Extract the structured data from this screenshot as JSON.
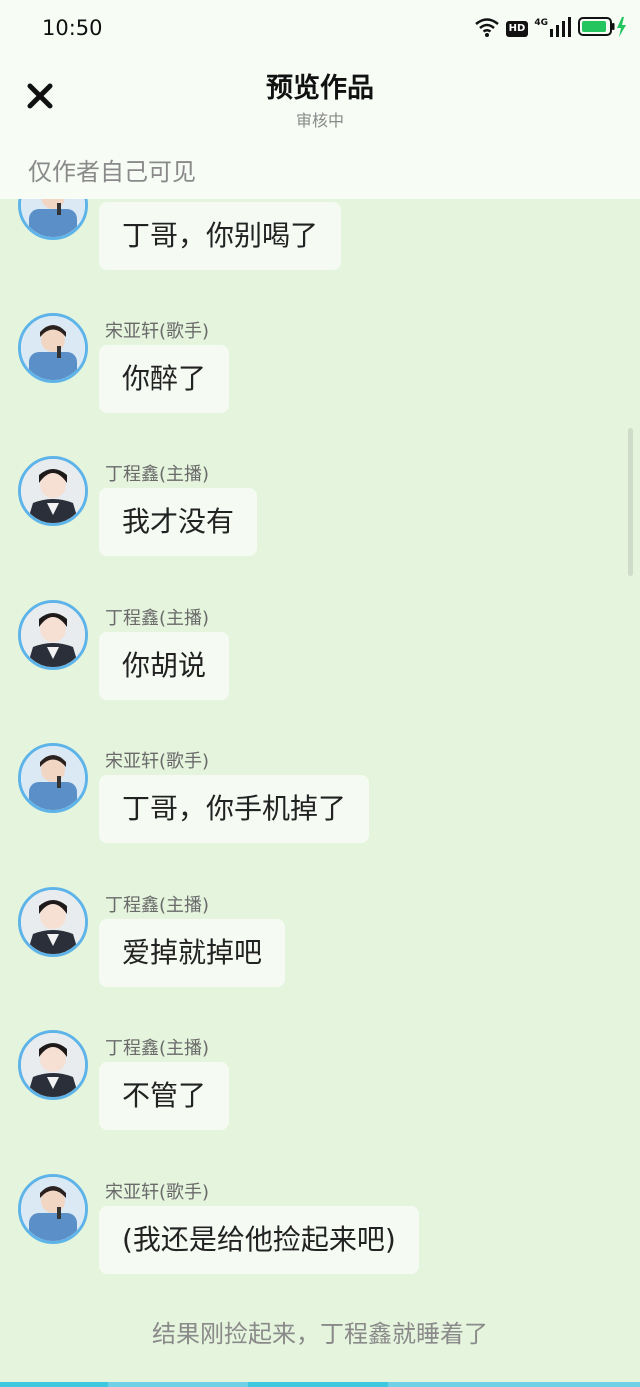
{
  "status_bar": {
    "time": "10:50",
    "hd_label": "HD",
    "network_label": "4G",
    "wifi_icon": "wifi-icon",
    "signal_icon": "signal-icon",
    "battery_icon": "battery-charging-icon",
    "battery_color": "#22c55e"
  },
  "header": {
    "title": "预览作品",
    "subtitle": "审核中",
    "visibility_note": "仅作者自己可见",
    "close_icon": "close-icon"
  },
  "messages": [
    {
      "sender": "",
      "text": "丁哥，你别喝了",
      "avatar": "songyaxuan-avatar"
    },
    {
      "sender": "宋亚轩(歌手)",
      "text": "你醉了",
      "avatar": "songyaxuan-avatar"
    },
    {
      "sender": "丁程鑫(主播)",
      "text": "我才没有",
      "avatar": "dingchengxin-avatar"
    },
    {
      "sender": "丁程鑫(主播)",
      "text": "你胡说",
      "avatar": "dingchengxin-avatar"
    },
    {
      "sender": "宋亚轩(歌手)",
      "text": "丁哥，你手机掉了",
      "avatar": "songyaxuan-avatar"
    },
    {
      "sender": "丁程鑫(主播)",
      "text": "爱掉就掉吧",
      "avatar": "dingchengxin-avatar"
    },
    {
      "sender": "丁程鑫(主播)",
      "text": "不管了",
      "avatar": "dingchengxin-avatar"
    },
    {
      "sender": "宋亚轩(歌手)",
      "text": "(我还是给他捡起来吧)",
      "avatar": "songyaxuan-avatar"
    }
  ],
  "narration": "结果刚捡起来，丁程鑫就睡着了",
  "colors": {
    "background": "#e5f4dd",
    "header_bg": "#f7fcf5",
    "bubble_bg": "#f5fbf3",
    "avatar_border": "#5eb4e8"
  }
}
